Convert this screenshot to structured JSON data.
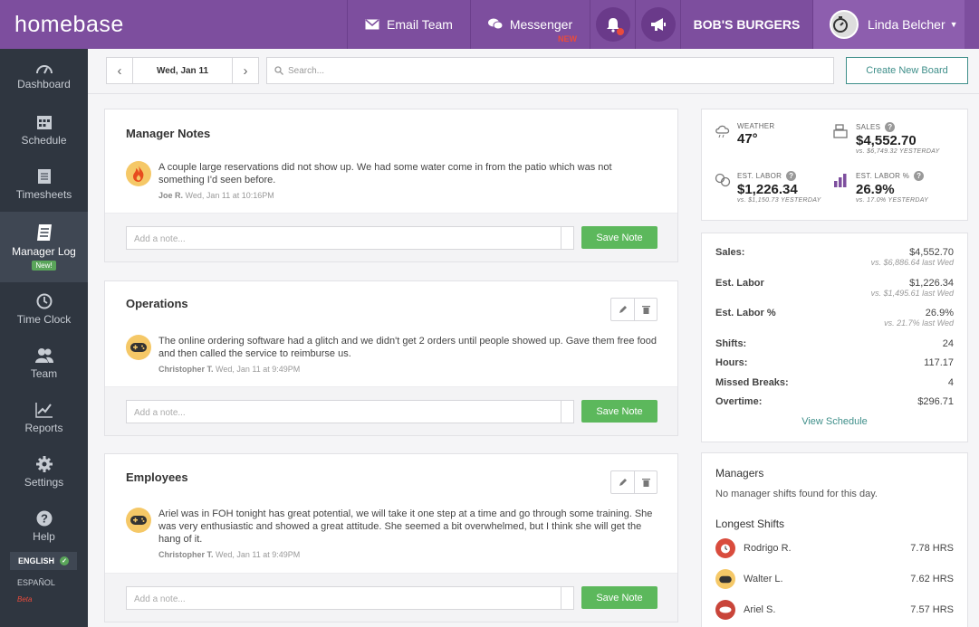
{
  "header": {
    "logo": "homebase",
    "email_team": "Email Team",
    "messenger": "Messenger",
    "messenger_badge": "NEW",
    "business": "BOB'S BURGERS",
    "user": "Linda Belcher"
  },
  "sidebar": {
    "items": [
      {
        "label": "Dashboard",
        "icon": "dashboard-icon"
      },
      {
        "label": "Schedule",
        "icon": "calendar-icon"
      },
      {
        "label": "Timesheets",
        "icon": "timesheet-icon"
      },
      {
        "label": "Manager Log",
        "icon": "log-icon",
        "badge": "New!"
      },
      {
        "label": "Time Clock",
        "icon": "clock-icon"
      },
      {
        "label": "Team",
        "icon": "team-icon"
      },
      {
        "label": "Reports",
        "icon": "reports-icon"
      },
      {
        "label": "Settings",
        "icon": "gear-icon"
      },
      {
        "label": "Help",
        "icon": "help-icon"
      }
    ],
    "lang_active": "ENGLISH",
    "lang_other": "ESPAÑOL",
    "lang_beta": "Beta"
  },
  "toolbar": {
    "date": "Wed, Jan 11",
    "search_placeholder": "Search...",
    "create_board": "Create New Board"
  },
  "boards": [
    {
      "title": "Manager Notes",
      "note": "A couple large reservations did not show up. We had some water come in from the patio which was not something I'd seen before.",
      "author": "Joe R.",
      "time": "Wed, Jan 11 at 10:16PM",
      "placeholder": "Add a note...",
      "save": "Save Note"
    },
    {
      "title": "Operations",
      "note": "The online ordering software had a glitch and we didn't get 2 orders until people showed up. Gave them free food and then called the service to reimburse us.",
      "author": "Christopher T.",
      "time": "Wed, Jan 11 at 9:49PM",
      "placeholder": "Add a note...",
      "save": "Save Note"
    },
    {
      "title": "Employees",
      "note": "Ariel was in FOH tonight has great potential, we will take it one step at a time and go through some training. She was very enthusiastic and showed a great attitude. She seemed a bit overwhelmed, but I think she will get the hang of it.",
      "author": "Christopher T.",
      "time": "Wed, Jan 11 at 9:49PM",
      "placeholder": "Add a note...",
      "save": "Save Note"
    }
  ],
  "kpis": {
    "weather": {
      "label": "WEATHER",
      "value": "47°"
    },
    "sales": {
      "label": "SALES",
      "value": "$4,552.70",
      "sub": "vs. $6,749.32 YESTERDAY"
    },
    "labor": {
      "label": "EST. LABOR",
      "value": "$1,226.34",
      "sub": "vs. $1,150.73 YESTERDAY"
    },
    "labor_pct": {
      "label": "EST. LABOR %",
      "value": "26.9%",
      "sub": "vs. 17.0% YESTERDAY"
    }
  },
  "summary": {
    "rows": [
      {
        "label": "Sales:",
        "value": "$4,552.70",
        "sub": "vs. $6,886.64 last Wed"
      },
      {
        "label": "Est. Labor",
        "value": "$1,226.34",
        "sub": "vs. $1,495.61 last Wed"
      },
      {
        "label": "Est. Labor %",
        "value": "26.9%",
        "sub": "vs. 21.7% last Wed"
      },
      {
        "label": "Shifts:",
        "value": "24"
      },
      {
        "label": "Hours:",
        "value": "117.17"
      },
      {
        "label": "Missed Breaks:",
        "value": "4"
      },
      {
        "label": "Overtime:",
        "value": "$296.71"
      }
    ],
    "link": "View Schedule"
  },
  "managers": {
    "title": "Managers",
    "empty": "No manager shifts found for this day.",
    "longest_title": "Longest Shifts",
    "shifts": [
      {
        "name": "Rodrigo R.",
        "hrs": "7.78 HRS"
      },
      {
        "name": "Walter L.",
        "hrs": "7.62 HRS"
      },
      {
        "name": "Ariel S.",
        "hrs": "7.57 HRS"
      }
    ]
  }
}
